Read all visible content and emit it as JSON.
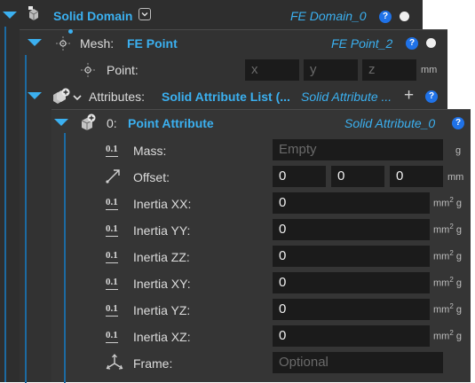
{
  "domain": {
    "title": "Solid Domain",
    "value": "FE Domain_0",
    "help": "?"
  },
  "mesh": {
    "label": "Mesh:",
    "value": "FE Point",
    "instance": "FE Point_2",
    "help": "?"
  },
  "point": {
    "label": "Point:",
    "x_placeholder": "x",
    "y_placeholder": "y",
    "z_placeholder": "z",
    "unit": "mm"
  },
  "attributes": {
    "label": "Attributes:",
    "value": "Solid Attribute List (...",
    "instance": "Solid Attribute ...",
    "add": "+",
    "help": "?"
  },
  "point_attribute": {
    "index": "0:",
    "title": "Point Attribute",
    "instance": "Solid Attribute_0",
    "help": "?"
  },
  "mass": {
    "label": "Mass:",
    "placeholder": "Empty",
    "unit": "g",
    "icon_text": "0.1"
  },
  "offset": {
    "label": "Offset:",
    "x": "0",
    "y": "0",
    "z": "0",
    "unit": "mm"
  },
  "inertia": [
    {
      "label": "Inertia XX:",
      "value": "0",
      "unit": "mm",
      "sup": "2",
      "unit2": " g",
      "icon_text": "0.1"
    },
    {
      "label": "Inertia YY:",
      "value": "0",
      "unit": "mm",
      "sup": "2",
      "unit2": " g",
      "icon_text": "0.1"
    },
    {
      "label": "Inertia ZZ:",
      "value": "0",
      "unit": "mm",
      "sup": "2",
      "unit2": " g",
      "icon_text": "0.1"
    },
    {
      "label": "Inertia XY:",
      "value": "0",
      "unit": "mm",
      "sup": "2",
      "unit2": " g",
      "icon_text": "0.1"
    },
    {
      "label": "Inertia YZ:",
      "value": "0",
      "unit": "mm",
      "sup": "2",
      "unit2": " g",
      "icon_text": "0.1"
    },
    {
      "label": "Inertia XZ:",
      "value": "0",
      "unit": "mm",
      "sup": "2",
      "unit2": " g",
      "icon_text": "0.1"
    }
  ],
  "frame": {
    "label": "Frame:",
    "placeholder": "Optional"
  },
  "colors": {
    "accent": "#3bb0f0",
    "help": "#1f72e8",
    "panel": "#2e2e2e",
    "field": "#1b1b1b"
  },
  "icons": [
    "solid-domain-icon",
    "dropdown-icon",
    "help-icon",
    "status-dot-icon",
    "point-mesh-icon",
    "attributes-icon",
    "numeric-field-icon",
    "vector-icon",
    "frame-axes-icon",
    "add-icon"
  ]
}
